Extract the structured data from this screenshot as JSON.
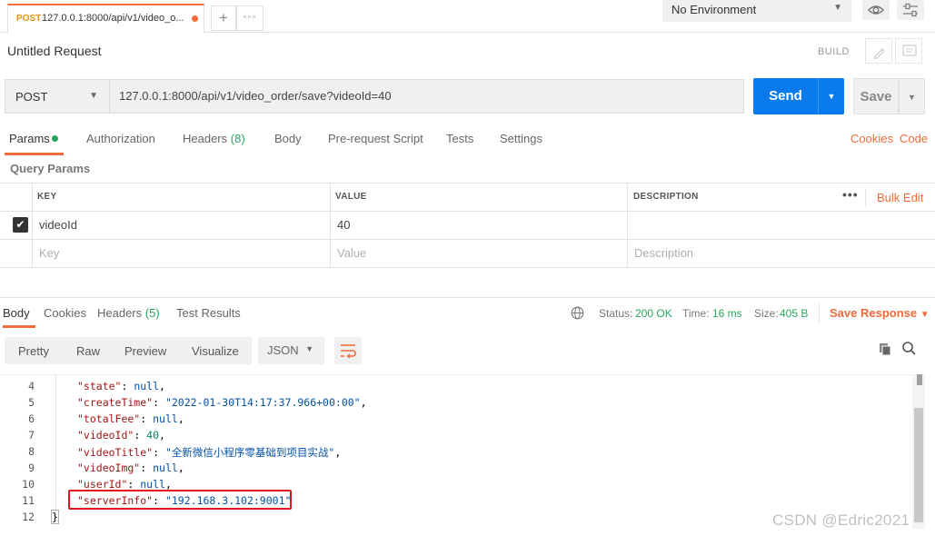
{
  "tabs": {
    "active": {
      "method": "POST",
      "url": "127.0.0.1:8000/api/v1/video_o..."
    },
    "new_tab": "+",
    "more": "◦◦◦"
  },
  "environment": {
    "label": "No Environment"
  },
  "request": {
    "title": "Untitled Request",
    "build_label": "BUILD",
    "method": "POST",
    "url": "127.0.0.1:8000/api/v1/video_order/save?videoId=40",
    "send_label": "Send",
    "save_label": "Save"
  },
  "request_tabs": {
    "params": "Params",
    "authorization": "Authorization",
    "headers": "Headers",
    "headers_count": "(8)",
    "body": "Body",
    "prerequest": "Pre-request Script",
    "tests": "Tests",
    "settings": "Settings",
    "cookies": "Cookies",
    "code": "Code"
  },
  "query_params": {
    "title": "Query Params",
    "columns": {
      "key": "KEY",
      "value": "VALUE",
      "description": "DESCRIPTION"
    },
    "bulk_edit": "Bulk Edit",
    "rows": [
      {
        "checked": true,
        "key": "videoId",
        "value": "40",
        "description": ""
      }
    ],
    "placeholder": {
      "key": "Key",
      "value": "Value",
      "description": "Description"
    }
  },
  "response_tabs": {
    "body": "Body",
    "cookies": "Cookies",
    "headers": "Headers",
    "headers_count": "(5)",
    "test_results": "Test Results"
  },
  "response_status": {
    "status_label": "Status:",
    "status_value": "200 OK",
    "time_label": "Time:",
    "time_value": "16 ms",
    "size_label": "Size:",
    "size_value": "405 B",
    "save_response": "Save Response"
  },
  "format_bar": {
    "pretty": "Pretty",
    "raw": "Raw",
    "preview": "Preview",
    "visualize": "Visualize",
    "json": "JSON"
  },
  "code_lines": [
    {
      "n": "4",
      "key": "\"state\"",
      "value": "null",
      "vtype": "nl",
      "comma": ","
    },
    {
      "n": "5",
      "key": "\"createTime\"",
      "value": "\"2022-01-30T14:17:37.966+00:00\"",
      "vtype": "s",
      "comma": ","
    },
    {
      "n": "6",
      "key": "\"totalFee\"",
      "value": "null",
      "vtype": "nl",
      "comma": ","
    },
    {
      "n": "7",
      "key": "\"videoId\"",
      "value": "40",
      "vtype": "nu",
      "comma": ","
    },
    {
      "n": "8",
      "key": "\"videoTitle\"",
      "value": "\"全新微信小程序零基础到项目实战\"",
      "vtype": "s",
      "comma": ","
    },
    {
      "n": "9",
      "key": "\"videoImg\"",
      "value": "null",
      "vtype": "nl",
      "comma": ","
    },
    {
      "n": "10",
      "key": "\"userId\"",
      "value": "null",
      "vtype": "nl",
      "comma": ","
    },
    {
      "n": "11",
      "key": "\"serverInfo\"",
      "value": "\"192.168.3.102:9001\"",
      "vtype": "s",
      "comma": ""
    }
  ],
  "last_line": {
    "n": "12",
    "text": "}"
  },
  "watermark": "CSDN @Edric2021",
  "colors": {
    "accent": "#f26b3a",
    "send": "#097bed",
    "success": "#26a65b",
    "highlight": "#e0141e"
  }
}
